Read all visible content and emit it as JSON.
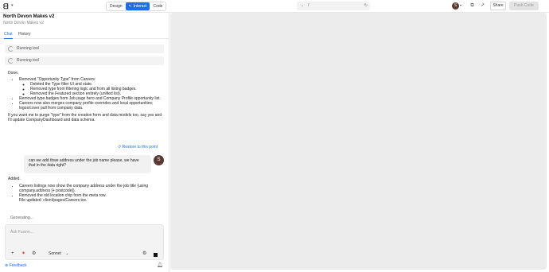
{
  "topbar": {
    "logo_icon": "builder-logo-icon",
    "modes": [
      {
        "label": "Design",
        "active": false
      },
      {
        "label": "Interact",
        "active": true
      },
      {
        "label": "Code",
        "active": false
      }
    ],
    "url": "/",
    "avatar_initial": "S",
    "share_label": "Share",
    "push_label": "Push Code"
  },
  "project": {
    "title": "North Devon Makes v2",
    "subtitle": "North Devon Makes v2"
  },
  "tabs": [
    {
      "label": "Chat",
      "active": true
    },
    {
      "label": "History",
      "active": false
    }
  ],
  "chat": {
    "tool_1": "Running tool",
    "tool_2": "Running tool",
    "assistant_1": {
      "done": "Done.",
      "b1": "Removed \"Opportunity Type\" from Careers:",
      "b1_sub": [
        "Deleted the Type filter UI and state.",
        "Removed type from filtering logic and from all listing badges.",
        "Removed the Featured section entirely (unified list)."
      ],
      "b2": "Removed type badges from Job page hero and Company Profile opportunity list.",
      "b3": "Careers now also merges company profile overrides and local opportunities; logos/cover pull from company data.",
      "footer": "If you want me to purge \"type\" from the creation form and data models too, say yes and I'll update CompanyDashboard and data schema."
    },
    "restore_label": "Restore to this point",
    "user_message": "can we add thwe address under the job name please, we have that in the data right?",
    "user_initial": "S",
    "assistant_2": {
      "added": "Added.",
      "b1": "Careers listings now show the company address under the job title (using company.address [+ postcode]).",
      "b2a": "Removed the old location chip from the meta row.",
      "b2b": "File updated: client/pages/Careers.tsx."
    },
    "generating": "Generating..."
  },
  "composer": {
    "placeholder": "Ask Fusion...",
    "model_label": "Sonnet"
  },
  "footer": {
    "feedback_label": "Feedback"
  },
  "colors": {
    "accent": "#1d6fe8",
    "preview_bg": "#ececec"
  }
}
